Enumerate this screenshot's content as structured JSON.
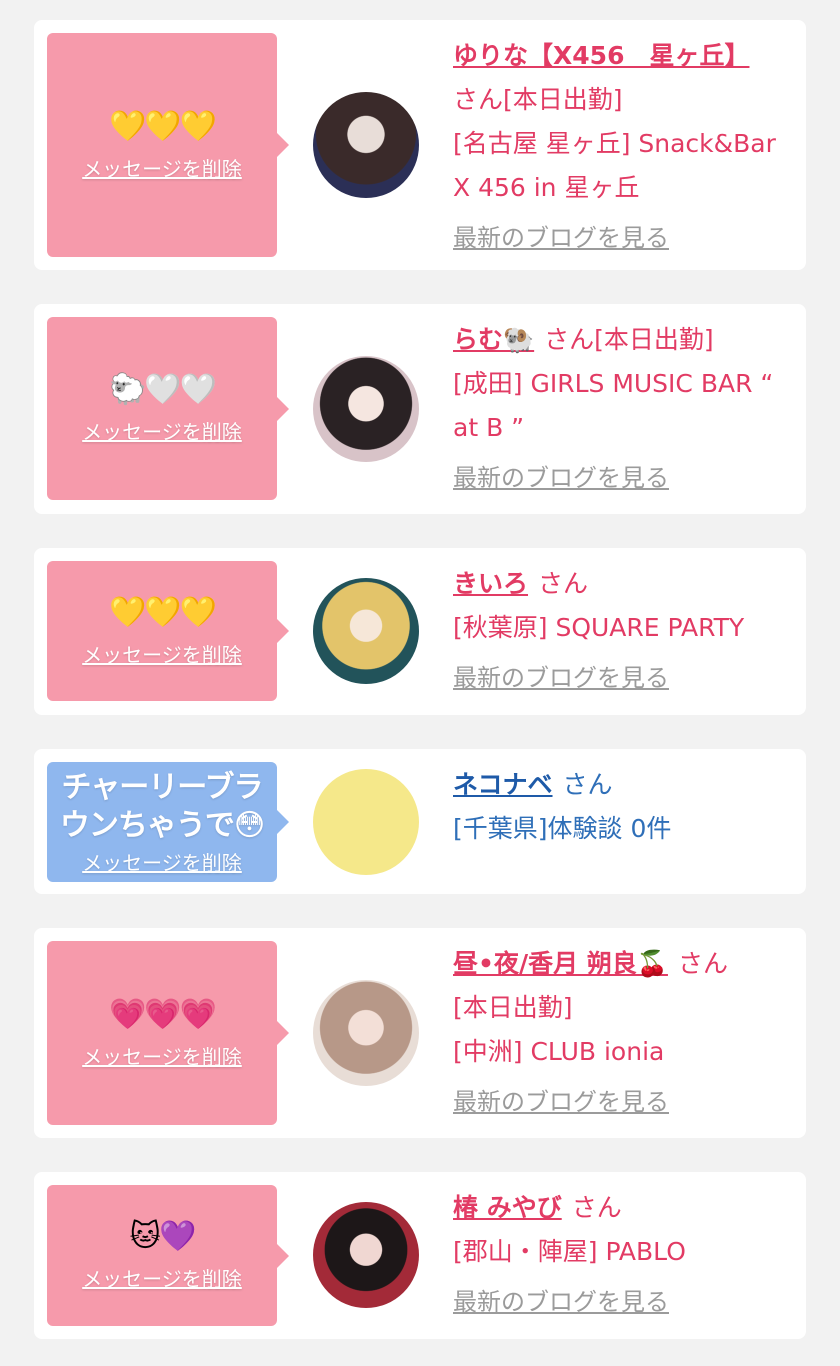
{
  "items": [
    {
      "bubble_color": "#f69aab",
      "bubble_emoji": "💛💛💛",
      "delete_label": "メッセージを削除",
      "name": "ゆりな【X456　星ヶ丘】",
      "honorific": "さん",
      "status": "[本日出勤]",
      "shop": "[名古屋 星ヶ丘] Snack&Bar X 456 in 星ヶ丘",
      "blog": "最新のブログを見る"
    },
    {
      "bubble_color": "#f69aab",
      "bubble_emoji": "🐑🤍🤍",
      "delete_label": "メッセージを削除",
      "name": "らむ🐏",
      "honorific": "さん",
      "status": "[本日出勤]",
      "shop": "[成田] GIRLS MUSIC BAR “ at B ”",
      "blog": "最新のブログを見る"
    },
    {
      "bubble_color": "#f69aab",
      "bubble_emoji": "💛💛💛",
      "delete_label": "メッセージを削除",
      "name": "きいろ",
      "honorific": "さん",
      "shop": "[秋葉原] SQUARE PARTY",
      "blog": "最新のブログを見る"
    },
    {
      "bubble_color": "#8fb7ee",
      "bubble_message": "チャーリーブラウンちゃうで😳",
      "delete_label": "メッセージを削除",
      "name": "ネコナベ",
      "honorific": "さん",
      "shop": "[千葉県]体験談 0件"
    },
    {
      "bubble_color": "#f69aab",
      "bubble_emoji": "💗💗💗",
      "delete_label": "メッセージを削除",
      "name": "昼•夜/香月 朔良🍒",
      "honorific": "さん",
      "status": "[本日出勤]",
      "shop": "[中洲] CLUB ionia",
      "blog": "最新のブログを見る"
    },
    {
      "bubble_color": "#f69aab",
      "bubble_emoji": "🐱💜",
      "delete_label": "メッセージを削除",
      "name": "椿 みやび",
      "honorific": "さん",
      "shop": "[郡山・陣屋] PABLO",
      "blog": "最新のブログを見る"
    }
  ]
}
